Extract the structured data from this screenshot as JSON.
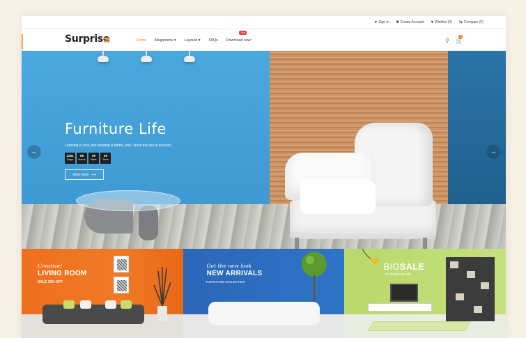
{
  "topbar": {
    "links": [
      {
        "icon": "user-icon",
        "label": "Sign In"
      },
      {
        "icon": "account-icon",
        "label": "Create Account"
      },
      {
        "icon": "heart-icon",
        "label": "Wishlist (0)"
      },
      {
        "icon": "compare-icon",
        "label": "Compare (0)"
      }
    ]
  },
  "header": {
    "logo": "Surprise",
    "nav": [
      {
        "label": "Home",
        "active": true
      },
      {
        "label": "Megamenu ▾"
      },
      {
        "label": "Layouts ▾"
      },
      {
        "label": "FAQs"
      },
      {
        "label": "Download now!"
      }
    ],
    "nav_badge": "Hot",
    "cart_count": "0",
    "icons": [
      "search-icon",
      "cart-icon"
    ],
    "accent_color": "#e8782c"
  },
  "hero": {
    "title": "Furniture Life",
    "subtitle": "Learning is cool, but knowing is better, and I know the key to success",
    "countdown": [
      {
        "value": "1261",
        "unit": "Days"
      },
      {
        "value": "08",
        "unit": "Hours"
      },
      {
        "value": "09",
        "unit": "Mins"
      },
      {
        "value": "09",
        "unit": "Secs"
      }
    ],
    "button_label": "View more",
    "button_arrow": "⟶",
    "prev_arrow": "←",
    "next_arrow": "→"
  },
  "banners": [
    {
      "script": "Creative!",
      "title": "LIVING ROOM",
      "caption": "SALE 30% OFF",
      "color": "#ee6f1f"
    },
    {
      "script": "Get the new look",
      "title": "NEW ARRIVALS",
      "caption": "FURNITURE COLLECTION",
      "color": "#2b67b8"
    },
    {
      "title_light": "BIG",
      "title_bold": "SALE",
      "caption": "ON EVERY BRAND",
      "color": "#b8d86a"
    }
  ]
}
